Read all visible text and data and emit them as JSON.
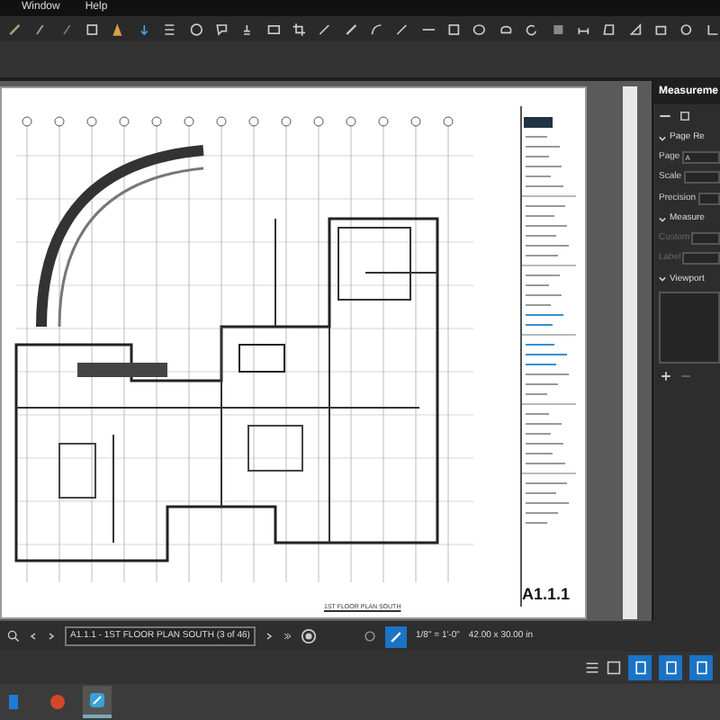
{
  "menu": [
    {
      "label": "Window"
    },
    {
      "label": "Help"
    }
  ],
  "sheet": {
    "sheet_number": "A1.1.1",
    "view_title": "1ST FLOOR PLAN SOUTH"
  },
  "panel": {
    "title": "Measureme",
    "sections": [
      {
        "title": "Page Re",
        "expanded": true,
        "fields": [
          {
            "label": "Page",
            "value": "A"
          },
          {
            "label": "Scale"
          },
          {
            "label": "Precision"
          }
        ]
      },
      {
        "title": "Measure",
        "expanded": true,
        "fields": [
          {
            "label": "Custom",
            "disabled": true
          },
          {
            "label": "Label",
            "disabled": true
          }
        ]
      },
      {
        "title": "Viewport",
        "expanded": true
      }
    ]
  },
  "status": {
    "page_field": "A1.1.1 - 1ST FLOOR PLAN SOUTH (3 of 46)",
    "scale": "1/8\" = 1'-0\"",
    "size": "42.00 x 30.00 in",
    "snap_on": true
  },
  "taskbar": [
    {
      "kind": "start",
      "selected": false
    },
    {
      "kind": "office",
      "selected": false
    },
    {
      "kind": "revu",
      "selected": true
    }
  ]
}
